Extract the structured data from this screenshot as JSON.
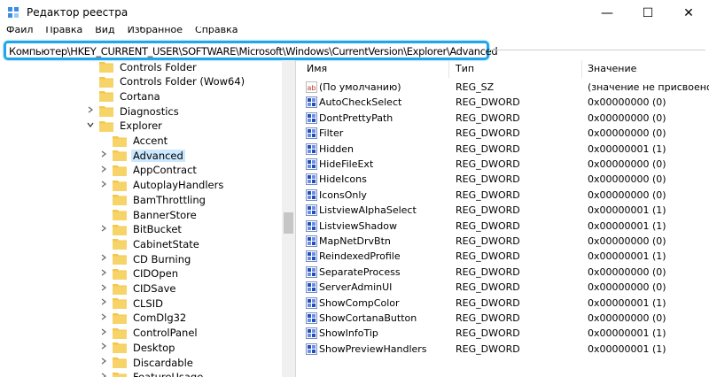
{
  "window": {
    "title": "Редактор реестра"
  },
  "window_controls": {
    "minimize": "—",
    "maximize": "☐",
    "close": "✕"
  },
  "menu": [
    "Файл",
    "Правка",
    "Вид",
    "Избранное",
    "Справка"
  ],
  "address": "Компьютер\\HKEY_CURRENT_USER\\SOFTWARE\\Microsoft\\Windows\\CurrentVersion\\Explorer\\Advanced",
  "colors": {
    "accent": "#22a6e8",
    "selection": "#cce8ff",
    "folder": "#f3c74b",
    "dword_icon": "#1f4fbf",
    "sz_icon": "#c0392b"
  },
  "tree": [
    {
      "label": "Controls Folder",
      "level": 0,
      "expander": ""
    },
    {
      "label": "Controls Folder (Wow64)",
      "level": 0,
      "expander": ""
    },
    {
      "label": "Cortana",
      "level": 0,
      "expander": ""
    },
    {
      "label": "Diagnostics",
      "level": 0,
      "expander": ">"
    },
    {
      "label": "Explorer",
      "level": 0,
      "expander": "v"
    },
    {
      "label": "Accent",
      "level": 1,
      "expander": ""
    },
    {
      "label": "Advanced",
      "level": 1,
      "expander": ">",
      "selected": true
    },
    {
      "label": "AppContract",
      "level": 1,
      "expander": ">"
    },
    {
      "label": "AutoplayHandlers",
      "level": 1,
      "expander": ">"
    },
    {
      "label": "BamThrottling",
      "level": 1,
      "expander": ""
    },
    {
      "label": "BannerStore",
      "level": 1,
      "expander": ""
    },
    {
      "label": "BitBucket",
      "level": 1,
      "expander": ">"
    },
    {
      "label": "CabinetState",
      "level": 1,
      "expander": ""
    },
    {
      "label": "CD Burning",
      "level": 1,
      "expander": ">"
    },
    {
      "label": "CIDOpen",
      "level": 1,
      "expander": ">"
    },
    {
      "label": "CIDSave",
      "level": 1,
      "expander": ">"
    },
    {
      "label": "CLSID",
      "level": 1,
      "expander": ">"
    },
    {
      "label": "ComDlg32",
      "level": 1,
      "expander": ">"
    },
    {
      "label": "ControlPanel",
      "level": 1,
      "expander": ">"
    },
    {
      "label": "Desktop",
      "level": 1,
      "expander": ">"
    },
    {
      "label": "Discardable",
      "level": 1,
      "expander": ">"
    },
    {
      "label": "FeatureUsage",
      "level": 1,
      "expander": ">"
    }
  ],
  "columns": {
    "name": "Имя",
    "type": "Тип",
    "value": "Значение"
  },
  "values": [
    {
      "name": "(По умолчанию)",
      "type": "REG_SZ",
      "value": "(значение не присвоено)",
      "icon": "ab"
    },
    {
      "name": "AutoCheckSelect",
      "type": "REG_DWORD",
      "value": "0x00000000 (0)",
      "icon": "dw"
    },
    {
      "name": "DontPrettyPath",
      "type": "REG_DWORD",
      "value": "0x00000000 (0)",
      "icon": "dw"
    },
    {
      "name": "Filter",
      "type": "REG_DWORD",
      "value": "0x00000000 (0)",
      "icon": "dw"
    },
    {
      "name": "Hidden",
      "type": "REG_DWORD",
      "value": "0x00000001 (1)",
      "icon": "dw"
    },
    {
      "name": "HideFileExt",
      "type": "REG_DWORD",
      "value": "0x00000000 (0)",
      "icon": "dw"
    },
    {
      "name": "HideIcons",
      "type": "REG_DWORD",
      "value": "0x00000000 (0)",
      "icon": "dw"
    },
    {
      "name": "IconsOnly",
      "type": "REG_DWORD",
      "value": "0x00000000 (0)",
      "icon": "dw"
    },
    {
      "name": "ListviewAlphaSelect",
      "type": "REG_DWORD",
      "value": "0x00000001 (1)",
      "icon": "dw"
    },
    {
      "name": "ListviewShadow",
      "type": "REG_DWORD",
      "value": "0x00000001 (1)",
      "icon": "dw"
    },
    {
      "name": "MapNetDrvBtn",
      "type": "REG_DWORD",
      "value": "0x00000000 (0)",
      "icon": "dw"
    },
    {
      "name": "ReindexedProfile",
      "type": "REG_DWORD",
      "value": "0x00000001 (1)",
      "icon": "dw"
    },
    {
      "name": "SeparateProcess",
      "type": "REG_DWORD",
      "value": "0x00000000 (0)",
      "icon": "dw"
    },
    {
      "name": "ServerAdminUI",
      "type": "REG_DWORD",
      "value": "0x00000000 (0)",
      "icon": "dw"
    },
    {
      "name": "ShowCompColor",
      "type": "REG_DWORD",
      "value": "0x00000001 (1)",
      "icon": "dw"
    },
    {
      "name": "ShowCortanaButton",
      "type": "REG_DWORD",
      "value": "0x00000000 (0)",
      "icon": "dw"
    },
    {
      "name": "ShowInfoTip",
      "type": "REG_DWORD",
      "value": "0x00000001 (1)",
      "icon": "dw"
    },
    {
      "name": "ShowPreviewHandlers",
      "type": "REG_DWORD",
      "value": "0x00000001 (1)",
      "icon": "dw"
    }
  ]
}
